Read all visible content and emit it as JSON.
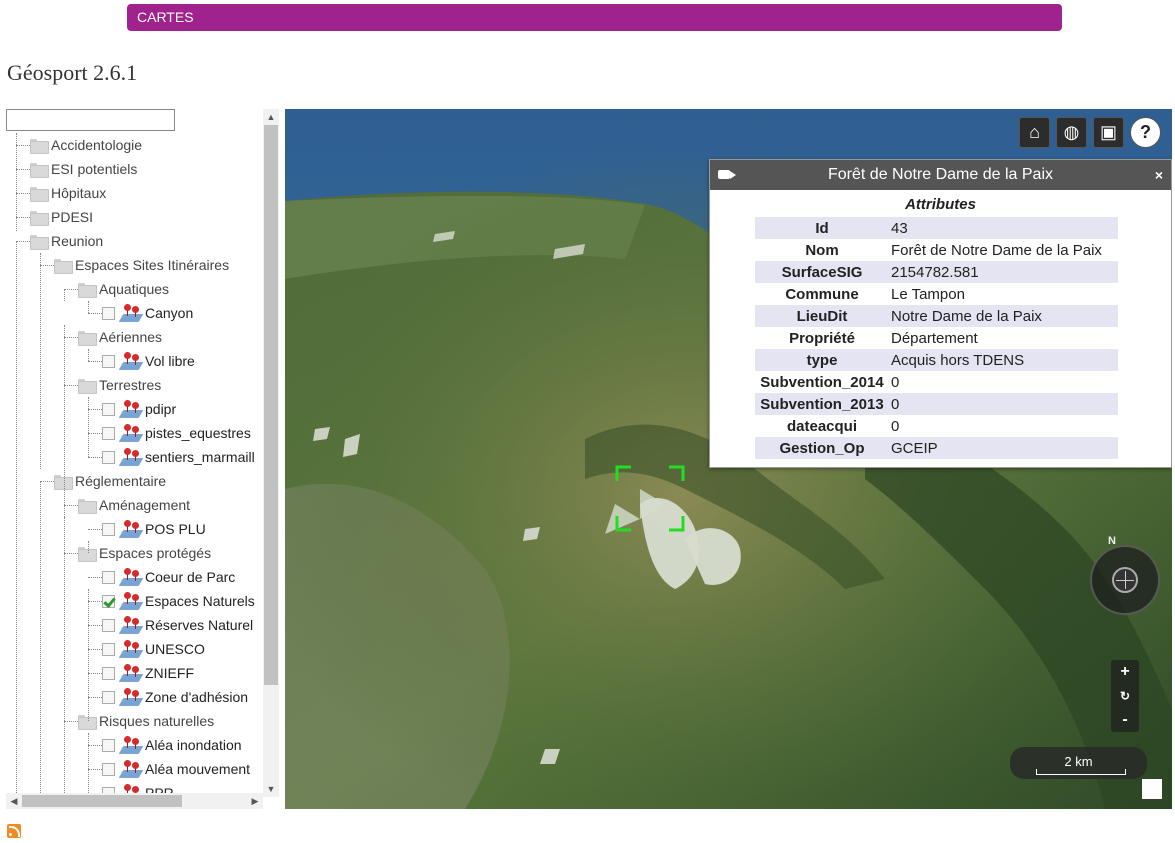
{
  "topbar": {
    "label": "CARTES"
  },
  "app": {
    "title": "Géosport 2.6.1"
  },
  "tree": {
    "search_value": "",
    "nodes": [
      {
        "label": "Accidentologie",
        "kind": "folder",
        "level": 0
      },
      {
        "label": "ESI potentiels",
        "kind": "folder",
        "level": 0
      },
      {
        "label": "Hôpitaux",
        "kind": "folder",
        "level": 0
      },
      {
        "label": "PDESI",
        "kind": "folder",
        "level": 0
      },
      {
        "label": "Reunion",
        "kind": "folder",
        "level": 0
      },
      {
        "label": "Espaces Sites Itinéraires",
        "kind": "folder",
        "level": 1
      },
      {
        "label": "Aquatiques",
        "kind": "folder",
        "level": 2
      },
      {
        "label": "Canyon",
        "kind": "layer",
        "level": 3,
        "checked": false
      },
      {
        "label": "Aériennes",
        "kind": "folder",
        "level": 2
      },
      {
        "label": "Vol libre",
        "kind": "layer",
        "level": 3,
        "checked": false
      },
      {
        "label": "Terrestres",
        "kind": "folder",
        "level": 2
      },
      {
        "label": "pdipr",
        "kind": "layer",
        "level": 3,
        "checked": false
      },
      {
        "label": "pistes_equestres",
        "kind": "layer",
        "level": 3,
        "checked": false
      },
      {
        "label": "sentiers_marmaill",
        "kind": "layer",
        "level": 3,
        "checked": false
      },
      {
        "label": "Réglementaire",
        "kind": "folder",
        "level": 1
      },
      {
        "label": "Aménagement",
        "kind": "folder",
        "level": 2
      },
      {
        "label": "POS PLU",
        "kind": "layer",
        "level": 3,
        "checked": false
      },
      {
        "label": "Espaces protégés",
        "kind": "folder",
        "level": 2
      },
      {
        "label": "Coeur de Parc",
        "kind": "layer",
        "level": 3,
        "checked": false
      },
      {
        "label": "Espaces Naturels",
        "kind": "layer",
        "level": 3,
        "checked": true
      },
      {
        "label": "Réserves Naturel",
        "kind": "layer",
        "level": 3,
        "checked": false
      },
      {
        "label": "UNESCO",
        "kind": "layer",
        "level": 3,
        "checked": false
      },
      {
        "label": "ZNIEFF",
        "kind": "layer",
        "level": 3,
        "checked": false
      },
      {
        "label": "Zone d'adhésion",
        "kind": "layer",
        "level": 3,
        "checked": false
      },
      {
        "label": "Risques naturelles",
        "kind": "folder",
        "level": 2
      },
      {
        "label": "Aléa inondation",
        "kind": "layer",
        "level": 3,
        "checked": false
      },
      {
        "label": "Aléa mouvement",
        "kind": "layer",
        "level": 3,
        "checked": false
      },
      {
        "label": "PPR",
        "kind": "layer",
        "level": 3,
        "checked": false
      }
    ]
  },
  "map": {
    "toolbar": [
      {
        "name": "home-icon",
        "glyph": "⌂"
      },
      {
        "name": "globe-icon",
        "glyph": "◍"
      },
      {
        "name": "map-mode-icon",
        "glyph": "▣"
      },
      {
        "name": "help-icon",
        "glyph": "?"
      }
    ],
    "popup": {
      "title": "Forêt de Notre Dame de la Paix",
      "close": "×",
      "section": "Attributes",
      "attributes": [
        {
          "key": "Id",
          "value": "43"
        },
        {
          "key": "Nom",
          "value": "Forêt de Notre Dame de la Paix"
        },
        {
          "key": "SurfaceSIG",
          "value": "2154782.581"
        },
        {
          "key": "Commune",
          "value": "Le Tampon"
        },
        {
          "key": "LieuDit",
          "value": "Notre Dame de la Paix"
        },
        {
          "key": "Propriété",
          "value": "Département"
        },
        {
          "key": "type",
          "value": "Acquis hors TDENS"
        },
        {
          "key": "Subvention_2014",
          "value": "0"
        },
        {
          "key": "Subvention_2013",
          "value": "0"
        },
        {
          "key": "dateacqui",
          "value": "0"
        },
        {
          "key": "Gestion_Op",
          "value": "GCEIP"
        }
      ]
    },
    "compass_label": "N",
    "zoom": {
      "in": "+",
      "reset": "↻",
      "out": "-"
    },
    "scale_label": "2 km",
    "colors": {
      "accent": "#a0228c",
      "checked": "#2e9a2e",
      "selection": "#22dd22"
    }
  }
}
